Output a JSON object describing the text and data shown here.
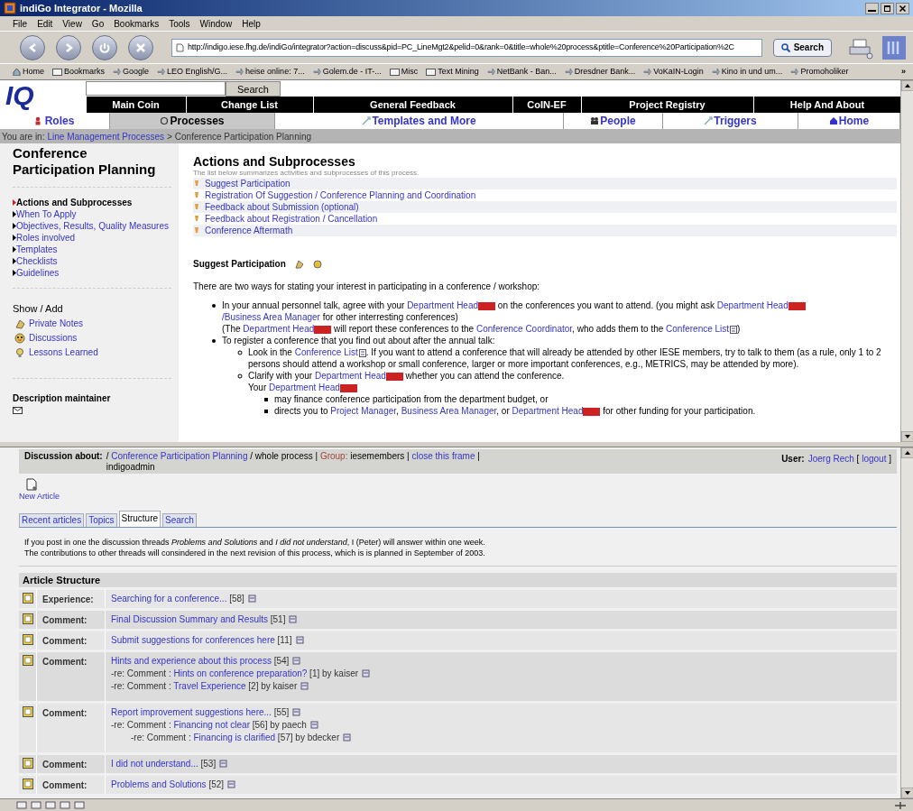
{
  "window": {
    "title": "indiGo Integrator - Mozilla"
  },
  "menu": [
    "File",
    "Edit",
    "View",
    "Go",
    "Bookmarks",
    "Tools",
    "Window",
    "Help"
  ],
  "address": {
    "url": "http://indigo.iese.fhg.de/indiGo/integrator?action=discuss&pid=PC_LineMgt2&pelid=0&rank=0&title=whole%20process&ptitle=Conference%20Participation%2C",
    "search_button": "Search"
  },
  "bookmarks": [
    {
      "kind": "home",
      "label": "Home"
    },
    {
      "kind": "folder",
      "label": "Bookmarks"
    },
    {
      "kind": "link",
      "label": "Google"
    },
    {
      "kind": "link",
      "label": "LEO English/G..."
    },
    {
      "kind": "link",
      "label": "heise online: 7..."
    },
    {
      "kind": "link",
      "label": "Golem.de - IT-..."
    },
    {
      "kind": "folder",
      "label": "Misc"
    },
    {
      "kind": "folder",
      "label": "Text Mining"
    },
    {
      "kind": "link",
      "label": "NetBank - Ban..."
    },
    {
      "kind": "link",
      "label": "Dresdner Bank..."
    },
    {
      "kind": "link",
      "label": "VoKaIN-Login"
    },
    {
      "kind": "link",
      "label": "Kino in und um..."
    },
    {
      "kind": "link",
      "label": "Promoholiker"
    }
  ],
  "bookmarks_more": "»",
  "site": {
    "logo": "IQ",
    "search_button": "Search",
    "top_nav": [
      "Main Coin",
      "Change List",
      "General Feedback",
      "CoIN-EF",
      "Project Registry",
      "Help And About"
    ],
    "main_nav": [
      {
        "label": "Roles",
        "selected": false
      },
      {
        "label": "Processes",
        "selected": true
      },
      {
        "label": "Templates and More",
        "selected": false
      },
      {
        "label": "People",
        "selected": false
      },
      {
        "label": "Triggers",
        "selected": false
      },
      {
        "label": "Home",
        "selected": false
      }
    ],
    "breadcrumb": {
      "label": "You are in:",
      "link": "Line Management Processes",
      "separator": ">",
      "current": "Conference Participation Planning"
    }
  },
  "sidebar": {
    "title": "Conference Participation Planning",
    "items": [
      {
        "label": "Actions and Subprocesses",
        "selected": true
      },
      {
        "label": "When To Apply",
        "selected": false
      },
      {
        "label": "Objectives, Results, Quality Measures",
        "selected": false
      },
      {
        "label": "Roles involved",
        "selected": false
      },
      {
        "label": "Templates",
        "selected": false
      },
      {
        "label": "Checklists",
        "selected": false
      },
      {
        "label": "Guidelines",
        "selected": false
      }
    ],
    "show_add": "Show / Add",
    "show_add_items": [
      {
        "kind": "notes",
        "label": "Private Notes"
      },
      {
        "kind": "discussions",
        "label": "Discussions"
      },
      {
        "kind": "lessons",
        "label": "Lessons Learned"
      }
    ],
    "maintainer": "Description maintainer"
  },
  "main": {
    "heading": "Actions and Subprocesses",
    "subtitle": "The list below summarizes activities and subprocesses of this process.",
    "actions": [
      "Suggest Participation",
      "Registration Of Suggestion / Conference Planning and Coordination",
      "Feedback about Submission (optional)",
      "Feedback about Registration / Cancellation",
      "Conference Aftermath"
    ],
    "section_title": "Suggest Participation",
    "intro": "There are two ways for stating your interest in participating in a conference / workshop:",
    "bullets": [
      {
        "lines": [
          [
            {
              "kind": "text",
              "text": "In your annual personnel talk, agree with your "
            },
            {
              "kind": "link",
              "text": "Department Head"
            },
            {
              "kind": "change"
            },
            {
              "kind": "text",
              "text": " on the conferences you want to attend. (you might ask "
            },
            {
              "kind": "link",
              "text": "Department Head"
            },
            {
              "kind": "change"
            },
            {
              "kind": "link",
              "text": "/Business Area Manager"
            },
            {
              "kind": "text",
              "text": " for other interresting conferences)"
            }
          ],
          [
            {
              "kind": "text",
              "text": "(The "
            },
            {
              "kind": "link",
              "text": "Department Head"
            },
            {
              "kind": "change"
            },
            {
              "kind": "text",
              "text": " will report these conferences to the "
            },
            {
              "kind": "link",
              "text": "Conference Coordinator"
            },
            {
              "kind": "text",
              "text": ", who adds them to the "
            },
            {
              "kind": "link",
              "text": "Conference List"
            },
            {
              "kind": "list"
            },
            {
              "kind": "text",
              "text": ")"
            }
          ]
        ]
      },
      {
        "lines": [
          [
            {
              "kind": "text",
              "text": "To register a conference that you find out about after the annual talk:"
            }
          ]
        ],
        "children": [
          {
            "lines": [
              [
                {
                  "kind": "text",
                  "text": "Look in the "
                },
                {
                  "kind": "link",
                  "text": "Conference List"
                },
                {
                  "kind": "list"
                },
                {
                  "kind": "text",
                  "text": ". If you want to attend a conference that will already be attended by other IESE members, try to talk to them (as a rule, only 1 to 2 persons should attend a workshop or small conference, larger or more important conferences, e.g., METRICS, may be attended by more)."
                }
              ]
            ]
          },
          {
            "lines": [
              [
                {
                  "kind": "text",
                  "text": "Clarify with your "
                },
                {
                  "kind": "link",
                  "text": "Department Head"
                },
                {
                  "kind": "change"
                },
                {
                  "kind": "text",
                  "text": " whether you can attend the conference."
                }
              ],
              [
                {
                  "kind": "text",
                  "text": "Your "
                },
                {
                  "kind": "link",
                  "text": "Department Head"
                },
                {
                  "kind": "change"
                }
              ]
            ],
            "children": [
              {
                "lines": [
                  [
                    {
                      "kind": "text",
                      "text": "may finance conference participation from the department budget, or"
                    }
                  ]
                ]
              },
              {
                "lines": [
                  [
                    {
                      "kind": "text",
                      "text": "directs you to "
                    },
                    {
                      "kind": "link",
                      "text": "Project Manager"
                    },
                    {
                      "kind": "text",
                      "text": ", "
                    },
                    {
                      "kind": "link",
                      "text": "Business Area Manager"
                    },
                    {
                      "kind": "text",
                      "text": ", or "
                    },
                    {
                      "kind": "link",
                      "text": "Department Head"
                    },
                    {
                      "kind": "change"
                    },
                    {
                      "kind": "text",
                      "text": " for other funding for your participation."
                    }
                  ]
                ]
              }
            ]
          }
        ]
      }
    ]
  },
  "discussion": {
    "about": [
      {
        "kind": "label",
        "text": "Discussion about:"
      },
      {
        "kind": "text",
        "text": " / "
      },
      {
        "kind": "link",
        "text": "Conference Participation Planning"
      },
      {
        "kind": "text",
        "text": " / whole process | "
      },
      {
        "kind": "group",
        "text": "Group:"
      },
      {
        "kind": "text",
        "text": " iesemembers      | "
      },
      {
        "kind": "link",
        "text": "close this frame"
      },
      {
        "kind": "text",
        "text": " |"
      }
    ],
    "about_line2": "indigoadmin",
    "user": [
      {
        "kind": "label",
        "text": "User:"
      },
      {
        "kind": "link",
        "text": "Joerg Rech"
      },
      {
        "kind": "text",
        "text": " [ "
      },
      {
        "kind": "link",
        "text": "logout"
      },
      {
        "kind": "text",
        "text": " ]"
      }
    ],
    "new_article": "New Article",
    "tabs": [
      {
        "label": "Recent articles",
        "selected": false
      },
      {
        "label": "Topics",
        "selected": false
      },
      {
        "label": "Structure",
        "selected": true
      },
      {
        "label": "Search",
        "selected": false
      }
    ],
    "info": [
      "If you post in one the discussion threads *Problems and Solutions* and *I did not understand*, I (Peter) will answer within one week.",
      "The contributions to other threads will consindered in the next revision of this process, which is is planned in September of 2003."
    ],
    "structure_title": "Article Structure",
    "articles": [
      {
        "type": "Experience:",
        "title": "Searching for a conference...",
        "count": "[58]"
      },
      {
        "type": "Comment:",
        "title": "Final Discussion Summary and Results",
        "count": "[51]"
      },
      {
        "type": "Comment:",
        "title": "Submit suggestions for conferences here",
        "count": "[11]"
      },
      {
        "type": "Comment:",
        "title": "Hints and experience about this process",
        "count": "[54]",
        "children": [
          {
            "prefix": "-re: Comment :",
            "title": "Hints on conference preparation?",
            "count": "[1]",
            "by": "by kaiser"
          },
          {
            "prefix": "-re: Comment :",
            "title": "Travel Experience",
            "count": "[2]",
            "by": "by kaiser"
          }
        ]
      },
      {
        "type": "Comment:",
        "title": "Report improvement suggestions here...",
        "count": "[55]",
        "children": [
          {
            "prefix": "-re: Comment :",
            "title": "Financing not clear",
            "count": "[56]",
            "by": "by paech",
            "children": [
              {
                "prefix": "-re: Comment :",
                "title": "Financing is clarified",
                "count": "[57]",
                "by": "by bdecker"
              }
            ]
          }
        ]
      },
      {
        "type": "Comment:",
        "title": "I did not understand...",
        "count": "[53]"
      },
      {
        "type": "Comment:",
        "title": "Problems and Solutions",
        "count": "[52]"
      }
    ]
  }
}
